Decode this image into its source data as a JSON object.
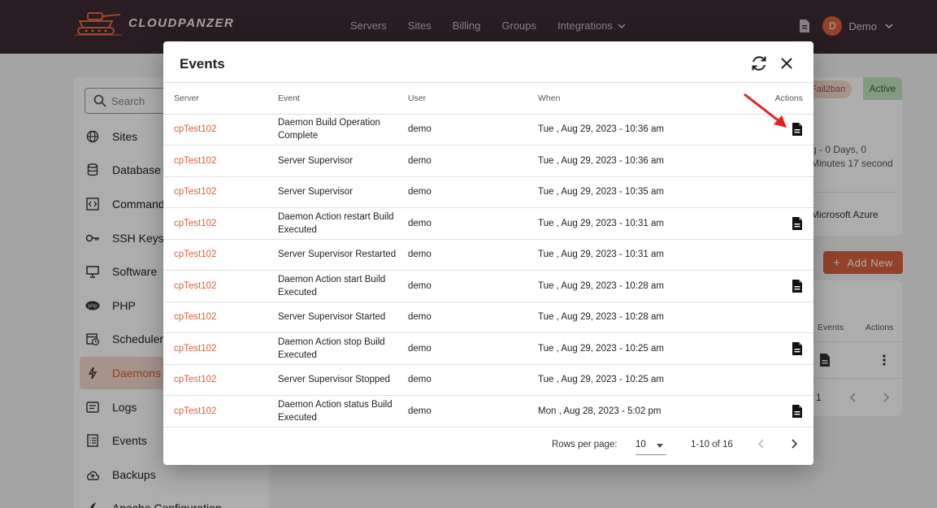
{
  "app": {
    "logo_text": "CLOUDPANZER",
    "nav": [
      "Servers",
      "Sites",
      "Billing",
      "Groups",
      "Integrations"
    ],
    "user_initial": "D",
    "user_name": "Demo"
  },
  "sidebar": {
    "search_placeholder": "Search",
    "items": [
      {
        "label": "Sites",
        "icon": "globe-icon"
      },
      {
        "label": "Database",
        "icon": "database-icon"
      },
      {
        "label": "Command",
        "icon": "terminal-icon"
      },
      {
        "label": "SSH Keys",
        "icon": "key-icon"
      },
      {
        "label": "Software",
        "icon": "monitor-icon"
      },
      {
        "label": "PHP",
        "icon": "php-icon"
      },
      {
        "label": "Scheduler",
        "icon": "calendar-clock-icon"
      },
      {
        "label": "Daemons",
        "icon": "bolt-icon"
      },
      {
        "label": "Logs",
        "icon": "log-icon"
      },
      {
        "label": "Events",
        "icon": "list-icon"
      },
      {
        "label": "Backups",
        "icon": "cloud-upload-icon"
      },
      {
        "label": "Apache Configuration",
        "icon": "feather-icon"
      }
    ]
  },
  "background": {
    "badge_fail2ban": "Fail2ban",
    "badge_active": "Active",
    "uptime_line1": "g - 0 Days, 0",
    "uptime_line2": "Minutes 17 second",
    "provider": "Microsoft Azure",
    "add_new": "Add New",
    "col_events": "Events",
    "col_actions": "Actions",
    "pagination_tail": "1"
  },
  "modal": {
    "title": "Events",
    "columns": {
      "server": "Server",
      "event": "Event",
      "user": "User",
      "when": "When",
      "actions": "Actions"
    },
    "rows": [
      {
        "server": "cpTest102",
        "event": "Daemon Build Operation Complete",
        "user": "demo",
        "when": "Tue , Aug 29, 2023 - 10:36 am",
        "has_doc": true
      },
      {
        "server": "cpTest102",
        "event": "Server Supervisor",
        "user": "demo",
        "when": "Tue , Aug 29, 2023 - 10:36 am",
        "has_doc": false
      },
      {
        "server": "cpTest102",
        "event": "Server Supervisor",
        "user": "demo",
        "when": "Tue , Aug 29, 2023 - 10:35 am",
        "has_doc": false
      },
      {
        "server": "cpTest102",
        "event": "Daemon Action restart Build Executed",
        "user": "demo",
        "when": "Tue , Aug 29, 2023 - 10:31 am",
        "has_doc": true
      },
      {
        "server": "cpTest102",
        "event": "Server Supervisor Restarted",
        "user": "demo",
        "when": "Tue , Aug 29, 2023 - 10:31 am",
        "has_doc": false
      },
      {
        "server": "cpTest102",
        "event": "Daemon Action start Build Executed",
        "user": "demo",
        "when": "Tue , Aug 29, 2023 - 10:28 am",
        "has_doc": true
      },
      {
        "server": "cpTest102",
        "event": "Server Supervisor Started",
        "user": "demo",
        "when": "Tue , Aug 29, 2023 - 10:28 am",
        "has_doc": false
      },
      {
        "server": "cpTest102",
        "event": "Daemon Action stop Build Executed",
        "user": "demo",
        "when": "Tue , Aug 29, 2023 - 10:25 am",
        "has_doc": true
      },
      {
        "server": "cpTest102",
        "event": "Server Supervisor Stopped",
        "user": "demo",
        "when": "Tue , Aug 29, 2023 - 10:25 am",
        "has_doc": false
      },
      {
        "server": "cpTest102",
        "event": "Daemon Action status Build Executed",
        "user": "demo",
        "when": "Mon , Aug 28, 2023 - 5:02 pm",
        "has_doc": true
      }
    ],
    "footer": {
      "rows_per_page_label": "Rows per page:",
      "rows_per_page_value": "10",
      "range": "1-10 of 16"
    }
  },
  "colors": {
    "accent": "#d9603b",
    "topbar": "#3d2a33"
  }
}
